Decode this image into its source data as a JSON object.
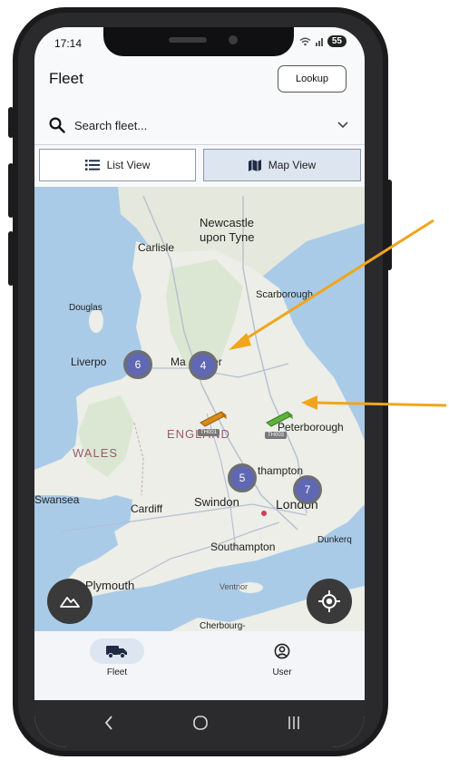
{
  "status_bar": {
    "time": "17:14",
    "battery": "55"
  },
  "header": {
    "title": "Fleet",
    "lookup_label": "Lookup"
  },
  "search": {
    "placeholder": "Search fleet..."
  },
  "view_toggle": {
    "list_label": "List View",
    "map_label": "Map View",
    "active": "map"
  },
  "map": {
    "place_labels": {
      "newcastle": "Newcastle\nupon Tyne",
      "carlisle": "Carlisle",
      "douglas": "Douglas",
      "scarborough": "Scarborough",
      "liverpool": "Liverpo",
      "manchester": "Ma    ester",
      "england": "ENGLAND",
      "peterborough": "Peterborough",
      "wales": "WALES",
      "northampton": "thampton",
      "swansea": "Swansea",
      "cardiff": "Cardiff",
      "swindon": "Swindon",
      "london": "London",
      "dunkerque": "Dunkerq",
      "southampton": "Southampton",
      "plymouth": "Plymouth",
      "ventnor": "Ventnor",
      "cherbourg": "Cherbourg-"
    },
    "clusters": [
      {
        "id": "liverpool",
        "count": "6"
      },
      {
        "id": "manchester",
        "count": "4"
      },
      {
        "id": "oxford",
        "count": "5"
      },
      {
        "id": "london",
        "count": "7"
      }
    ],
    "trucks": [
      {
        "id": "TH001",
        "color": "#d98a1b"
      },
      {
        "id": "TH003",
        "color": "#5fb33d"
      }
    ]
  },
  "bottom_nav": {
    "fleet_label": "Fleet",
    "user_label": "User"
  },
  "colors": {
    "accent": "#6068b3",
    "arrow": "#f2a51b",
    "active_tab": "#dde5f0"
  }
}
